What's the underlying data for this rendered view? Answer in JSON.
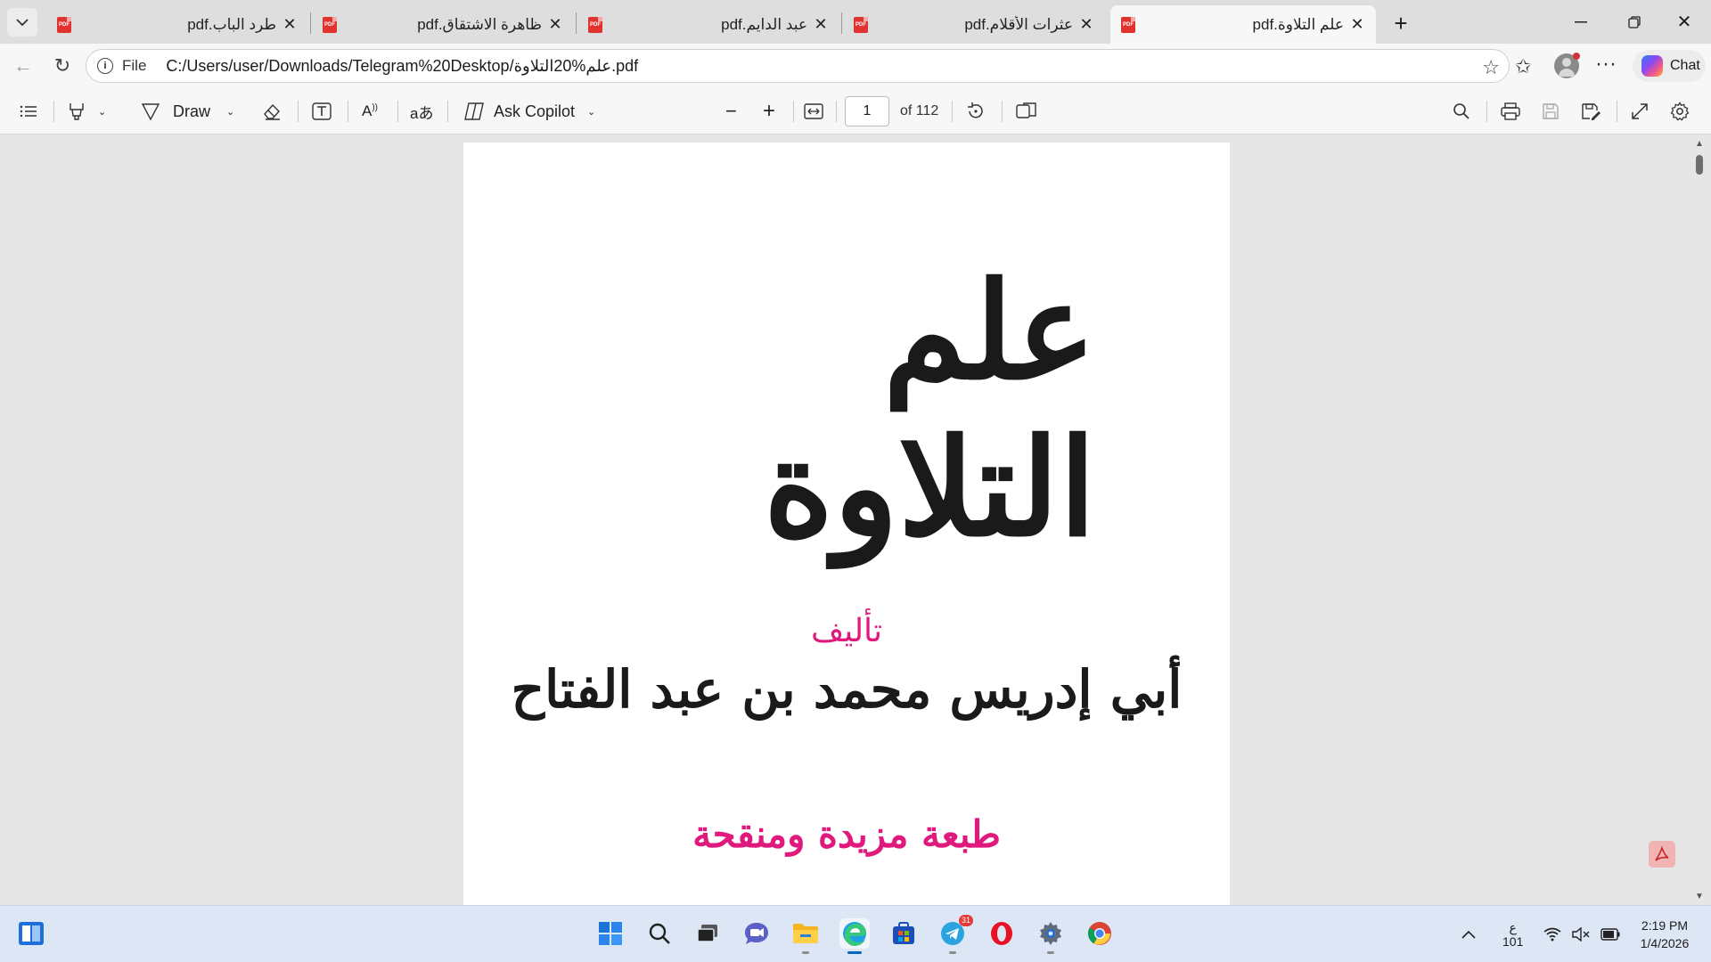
{
  "tabs": [
    {
      "title": "طرد الباب.pdf",
      "active": false
    },
    {
      "title": "ظاهرة الاشتقاق.pdf",
      "active": false
    },
    {
      "title": "عبد الدايم.pdf",
      "active": false
    },
    {
      "title": "عثرات الأقلام.pdf",
      "active": false
    },
    {
      "title": "علم التلاوة.pdf",
      "active": true
    }
  ],
  "address": {
    "scheme": "File",
    "url": "C:/Users/user/Downloads/Telegram%20Desktop/علم%20التلاوة.pdf"
  },
  "chat_label": "Chat",
  "toolbar": {
    "draw_label": "Draw",
    "ask_copilot_label": "Ask Copilot",
    "page_number": "1",
    "page_of": "of 112"
  },
  "document": {
    "title": "علم التلاوة",
    "author_label": "تأليف",
    "author_name": "أبي إدريس محمد بن عبد الفتاح",
    "edition": "طبعة مزيدة ومنقحة"
  },
  "taskbar": {
    "tray_lang_top": "ع",
    "tray_lang_bottom": "101",
    "time": "2:19 PM",
    "date": "1/4/2026",
    "telegram_badge": "31"
  },
  "colors": {
    "accent_pink": "#e0197d",
    "pdf_red": "#e0332f",
    "edge_blue": "#0067c0"
  }
}
